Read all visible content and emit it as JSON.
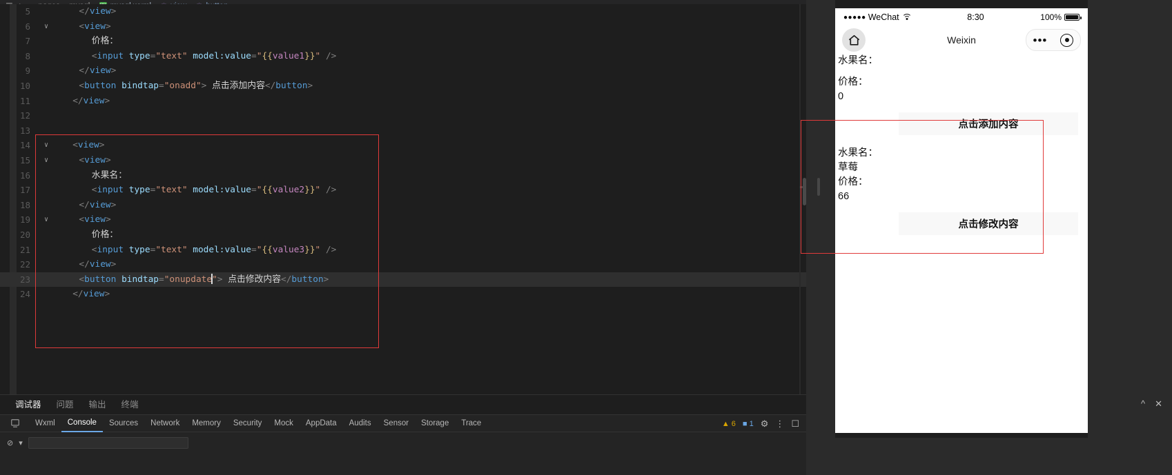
{
  "breadcrumb": {
    "icons": [
      "menu-icon",
      "home-icon",
      "back-arrow",
      "forward-arrow"
    ],
    "items": [
      "pages",
      "mysql"
    ],
    "file": "mysql.wxml",
    "symbols": [
      "view",
      "button"
    ],
    "separator": "›"
  },
  "editor": {
    "lines": [
      {
        "num": "5",
        "indent": 2,
        "fold": "",
        "active": false,
        "tokens": [
          {
            "t": "punc",
            "v": "</"
          },
          {
            "t": "tag",
            "v": "view"
          },
          {
            "t": "punc",
            "v": ">"
          }
        ]
      },
      {
        "num": "6",
        "indent": 2,
        "fold": "∨",
        "active": false,
        "tokens": [
          {
            "t": "punc",
            "v": "<"
          },
          {
            "t": "tag",
            "v": "view"
          },
          {
            "t": "punc",
            "v": ">"
          }
        ]
      },
      {
        "num": "7",
        "indent": 4,
        "fold": "",
        "active": false,
        "tokens": [
          {
            "t": "txt",
            "v": "价格："
          }
        ]
      },
      {
        "num": "8",
        "indent": 4,
        "fold": "",
        "active": false,
        "tokens": [
          {
            "t": "punc",
            "v": "<"
          },
          {
            "t": "tag",
            "v": "input"
          },
          {
            "t": "plain",
            "v": " "
          },
          {
            "t": "attr",
            "v": "type"
          },
          {
            "t": "punc",
            "v": "="
          },
          {
            "t": "str",
            "v": "\"text\""
          },
          {
            "t": "plain",
            "v": " "
          },
          {
            "t": "attr",
            "v": "model:value"
          },
          {
            "t": "punc",
            "v": "="
          },
          {
            "t": "str",
            "v": "\""
          },
          {
            "t": "mus",
            "v": "{{"
          },
          {
            "t": "var",
            "v": "value1"
          },
          {
            "t": "mus",
            "v": "}}"
          },
          {
            "t": "str",
            "v": "\""
          },
          {
            "t": "plain",
            "v": " "
          },
          {
            "t": "punc",
            "v": "/>"
          }
        ]
      },
      {
        "num": "9",
        "indent": 2,
        "fold": "",
        "active": false,
        "tokens": [
          {
            "t": "punc",
            "v": "</"
          },
          {
            "t": "tag",
            "v": "view"
          },
          {
            "t": "punc",
            "v": ">"
          }
        ]
      },
      {
        "num": "10",
        "indent": 2,
        "fold": "",
        "active": false,
        "tokens": [
          {
            "t": "punc",
            "v": "<"
          },
          {
            "t": "tag",
            "v": "button"
          },
          {
            "t": "plain",
            "v": " "
          },
          {
            "t": "attr",
            "v": "bindtap"
          },
          {
            "t": "punc",
            "v": "="
          },
          {
            "t": "str",
            "v": "\"onadd\""
          },
          {
            "t": "punc",
            "v": ">"
          },
          {
            "t": "txt",
            "v": " 点击添加内容"
          },
          {
            "t": "punc",
            "v": "</"
          },
          {
            "t": "tag",
            "v": "button"
          },
          {
            "t": "punc",
            "v": ">"
          }
        ]
      },
      {
        "num": "11",
        "indent": 1,
        "fold": "",
        "active": false,
        "tokens": [
          {
            "t": "punc",
            "v": "</"
          },
          {
            "t": "tag",
            "v": "view"
          },
          {
            "t": "punc",
            "v": ">"
          }
        ]
      },
      {
        "num": "12",
        "indent": 0,
        "fold": "",
        "active": false,
        "tokens": []
      },
      {
        "num": "13",
        "indent": 0,
        "fold": "",
        "active": false,
        "tokens": []
      },
      {
        "num": "14",
        "indent": 1,
        "fold": "∨",
        "active": false,
        "tokens": [
          {
            "t": "punc",
            "v": "<"
          },
          {
            "t": "tag",
            "v": "view"
          },
          {
            "t": "punc",
            "v": ">"
          }
        ]
      },
      {
        "num": "15",
        "indent": 2,
        "fold": "∨",
        "active": false,
        "tokens": [
          {
            "t": "punc",
            "v": "<"
          },
          {
            "t": "tag",
            "v": "view"
          },
          {
            "t": "punc",
            "v": ">"
          }
        ]
      },
      {
        "num": "16",
        "indent": 4,
        "fold": "",
        "active": false,
        "tokens": [
          {
            "t": "txt",
            "v": "水果名："
          }
        ]
      },
      {
        "num": "17",
        "indent": 4,
        "fold": "",
        "active": false,
        "tokens": [
          {
            "t": "punc",
            "v": "<"
          },
          {
            "t": "tag",
            "v": "input"
          },
          {
            "t": "plain",
            "v": " "
          },
          {
            "t": "attr",
            "v": "type"
          },
          {
            "t": "punc",
            "v": "="
          },
          {
            "t": "str",
            "v": "\"text\""
          },
          {
            "t": "plain",
            "v": " "
          },
          {
            "t": "attr",
            "v": "model:value"
          },
          {
            "t": "punc",
            "v": "="
          },
          {
            "t": "str",
            "v": "\""
          },
          {
            "t": "mus",
            "v": "{{"
          },
          {
            "t": "var",
            "v": "value2"
          },
          {
            "t": "mus",
            "v": "}}"
          },
          {
            "t": "str",
            "v": "\""
          },
          {
            "t": "plain",
            "v": " "
          },
          {
            "t": "punc",
            "v": "/>"
          }
        ]
      },
      {
        "num": "18",
        "indent": 2,
        "fold": "",
        "active": false,
        "tokens": [
          {
            "t": "punc",
            "v": "</"
          },
          {
            "t": "tag",
            "v": "view"
          },
          {
            "t": "punc",
            "v": ">"
          }
        ]
      },
      {
        "num": "19",
        "indent": 2,
        "fold": "∨",
        "active": false,
        "tokens": [
          {
            "t": "punc",
            "v": "<"
          },
          {
            "t": "tag",
            "v": "view"
          },
          {
            "t": "punc",
            "v": ">"
          }
        ]
      },
      {
        "num": "20",
        "indent": 4,
        "fold": "",
        "active": false,
        "tokens": [
          {
            "t": "txt",
            "v": "价格："
          }
        ]
      },
      {
        "num": "21",
        "indent": 4,
        "fold": "",
        "active": false,
        "tokens": [
          {
            "t": "punc",
            "v": "<"
          },
          {
            "t": "tag",
            "v": "input"
          },
          {
            "t": "plain",
            "v": " "
          },
          {
            "t": "attr",
            "v": "type"
          },
          {
            "t": "punc",
            "v": "="
          },
          {
            "t": "str",
            "v": "\"text\""
          },
          {
            "t": "plain",
            "v": " "
          },
          {
            "t": "attr",
            "v": "model:value"
          },
          {
            "t": "punc",
            "v": "="
          },
          {
            "t": "str",
            "v": "\""
          },
          {
            "t": "mus",
            "v": "{{"
          },
          {
            "t": "var",
            "v": "value3"
          },
          {
            "t": "mus",
            "v": "}}"
          },
          {
            "t": "str",
            "v": "\""
          },
          {
            "t": "plain",
            "v": " "
          },
          {
            "t": "punc",
            "v": "/>"
          }
        ]
      },
      {
        "num": "22",
        "indent": 2,
        "fold": "",
        "active": false,
        "tokens": [
          {
            "t": "punc",
            "v": "</"
          },
          {
            "t": "tag",
            "v": "view"
          },
          {
            "t": "punc",
            "v": ">"
          }
        ]
      },
      {
        "num": "23",
        "indent": 2,
        "fold": "",
        "active": true,
        "tokens": [
          {
            "t": "punc",
            "v": "<"
          },
          {
            "t": "tag",
            "v": "button"
          },
          {
            "t": "plain",
            "v": " "
          },
          {
            "t": "attr",
            "v": "bindtap"
          },
          {
            "t": "punc",
            "v": "="
          },
          {
            "t": "str",
            "v": "\"onupdate"
          },
          {
            "t": "caret",
            "v": ""
          },
          {
            "t": "str",
            "v": "\""
          },
          {
            "t": "punc",
            "v": ">"
          },
          {
            "t": "txt",
            "v": " 点击修改内容"
          },
          {
            "t": "punc",
            "v": "</"
          },
          {
            "t": "tag",
            "v": "button"
          },
          {
            "t": "punc",
            "v": ">"
          }
        ]
      },
      {
        "num": "24",
        "indent": 1,
        "fold": "",
        "active": false,
        "tokens": [
          {
            "t": "punc",
            "v": "</"
          },
          {
            "t": "tag",
            "v": "view"
          },
          {
            "t": "punc",
            "v": ">"
          }
        ]
      }
    ],
    "annotation_color": "#e03a3a"
  },
  "simulator": {
    "status": {
      "carrier": "WeChat",
      "signal_dots": "●●●●●",
      "time": "8:30",
      "battery_label": "100%"
    },
    "nav": {
      "home_icon": "home-icon",
      "title": "Weixin",
      "menu_icon": "ellipsis-icon",
      "target_icon": "target-icon"
    },
    "block1": {
      "fruit_label": "水果名：",
      "fruit_value": "",
      "price_label": "价格：",
      "price_value": "0",
      "button": "点击添加内容"
    },
    "block2": {
      "fruit_label": "水果名：",
      "fruit_value": "草莓",
      "price_label": "价格：",
      "price_value": "66",
      "button": "点击修改内容"
    }
  },
  "panel": {
    "tabs": [
      {
        "label": "调试器",
        "active": true
      },
      {
        "label": "问题",
        "active": false
      },
      {
        "label": "输出",
        "active": false
      },
      {
        "label": "终端",
        "active": false
      }
    ],
    "collapse_icon": "chevron-up-icon",
    "close_icon": "close-icon"
  },
  "devtools": {
    "inspect_icon": "inspect-icon",
    "tabs": [
      {
        "label": "Wxml",
        "active": false
      },
      {
        "label": "Console",
        "active": true
      },
      {
        "label": "Sources",
        "active": false
      },
      {
        "label": "Network",
        "active": false
      },
      {
        "label": "Memory",
        "active": false
      },
      {
        "label": "Security",
        "active": false
      },
      {
        "label": "Mock",
        "active": false
      },
      {
        "label": "AppData",
        "active": false
      },
      {
        "label": "Audits",
        "active": false
      },
      {
        "label": "Sensor",
        "active": false
      },
      {
        "label": "Storage",
        "active": false
      },
      {
        "label": "Trace",
        "active": false
      }
    ],
    "warning_count": "6",
    "error_count": "1",
    "warning_icon": "warning-triangle-icon",
    "error_icon": "message-icon",
    "settings_icon": "gear-icon",
    "more_icon": "kebab-icon",
    "dock_icon": "dock-icon"
  },
  "colors": {
    "accent": "#6ba8e6",
    "annotation": "#e03a3a",
    "editor_bg": "#1e1e1e",
    "panel_bg": "#242424"
  }
}
